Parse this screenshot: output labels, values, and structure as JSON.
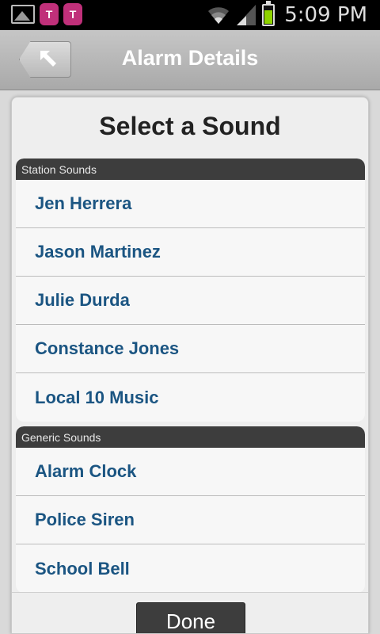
{
  "status_bar": {
    "time": "5:09 PM",
    "notification_icons": [
      "image-icon",
      "t-mobile-icon",
      "t-mobile-icon"
    ],
    "carrier_glyph": "T",
    "battery_color": "#8fd400"
  },
  "header": {
    "title": "Alarm Details",
    "back_icon": "back-arrow-icon"
  },
  "dialog": {
    "title": "Select a Sound",
    "sections": [
      {
        "heading": "Station Sounds",
        "items": [
          "Jen Herrera",
          "Jason Martinez",
          "Julie Durda",
          "Constance Jones",
          "Local 10 Music"
        ]
      },
      {
        "heading": "Generic Sounds",
        "items": [
          "Alarm Clock",
          "Police Siren",
          "School Bell"
        ]
      }
    ],
    "done_label": "Done"
  },
  "colors": {
    "item_text": "#1b5582",
    "section_header": "#3d3d3d"
  }
}
